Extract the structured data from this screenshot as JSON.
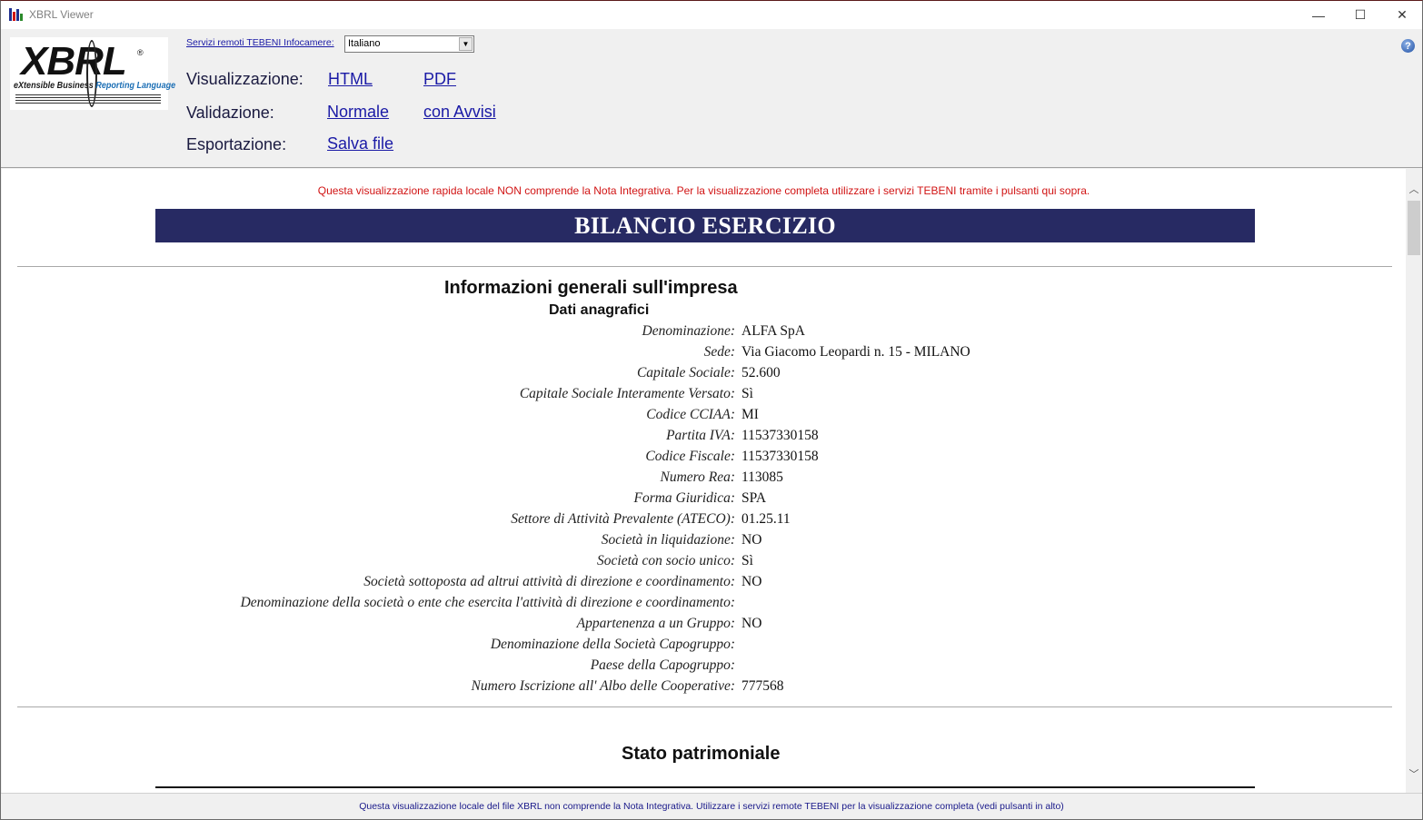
{
  "window": {
    "title": "XBRL Viewer",
    "minimize": "—",
    "maximize": "☐",
    "close": "✕"
  },
  "logo": {
    "wordmark": "XBRL",
    "registered": "®",
    "tagline_a": "eXtensible Business ",
    "tagline_b": "Reporting Language"
  },
  "toolbar": {
    "remote_link": "Servizi remoti TEBENI Infocamere:",
    "language_selected": "Italiano",
    "visualizzazione_label": "Visualizzazione:",
    "html_link": "HTML",
    "pdf_link": "PDF",
    "validazione_label": "Validazione:",
    "normale_link": "Normale",
    "avvisi_link": "con Avvisi",
    "esportazione_label": "Esportazione:",
    "salva_link": "Salva file",
    "help_glyph": "?"
  },
  "document": {
    "warning": "Questa visualizzazione rapida locale NON comprende la Nota Integrativa. Per la visualizzazione completa utilizzare i servizi TEBENI tramite i pulsanti qui sopra.",
    "banner": "BILANCIO ESERCIZIO",
    "section_info": "Informazioni generali sull'impresa",
    "subsection_dati": "Dati anagrafici",
    "fields": [
      {
        "label": "Denominazione:",
        "value": "ALFA SpA"
      },
      {
        "label": "Sede:",
        "value": "Via Giacomo Leopardi n. 15 - MILANO"
      },
      {
        "label": "Capitale Sociale:",
        "value": "52.600"
      },
      {
        "label": "Capitale Sociale Interamente Versato:",
        "value": "Sì"
      },
      {
        "label": "Codice CCIAA:",
        "value": "MI"
      },
      {
        "label": "Partita IVA:",
        "value": "11537330158"
      },
      {
        "label": "Codice Fiscale:",
        "value": "11537330158"
      },
      {
        "label": "Numero Rea:",
        "value": "113085"
      },
      {
        "label": "Forma Giuridica:",
        "value": "SPA"
      },
      {
        "label": "Settore di Attività Prevalente (ATECO):",
        "value": "01.25.11"
      },
      {
        "label": "Società in liquidazione:",
        "value": "NO"
      },
      {
        "label": "Società con socio unico:",
        "value": "Sì"
      },
      {
        "label": "Società sottoposta ad altrui attività di direzione e coordinamento:",
        "value": "NO"
      },
      {
        "label": "Denominazione della società o ente che esercita l'attività di direzione e coordinamento:",
        "value": ""
      },
      {
        "label": "Appartenenza a un Gruppo:",
        "value": "NO"
      },
      {
        "label": "Denominazione della Società Capogruppo:",
        "value": ""
      },
      {
        "label": "Paese della Capogruppo:",
        "value": ""
      },
      {
        "label": "Numero Iscrizione all' Albo delle Cooperative:",
        "value": "777568"
      }
    ],
    "section_stato": "Stato patrimoniale"
  },
  "statusbar": {
    "text": "Questa visualizzazione locale del file XBRL non comprende la Nota Integrativa. Utilizzare i servizi remote TEBENI per la visualizzazione completa (vedi pulsanti in alto)"
  },
  "colors": {
    "banner_bg": "#272a63",
    "link": "#1a1aa6",
    "warning": "#d11414"
  }
}
